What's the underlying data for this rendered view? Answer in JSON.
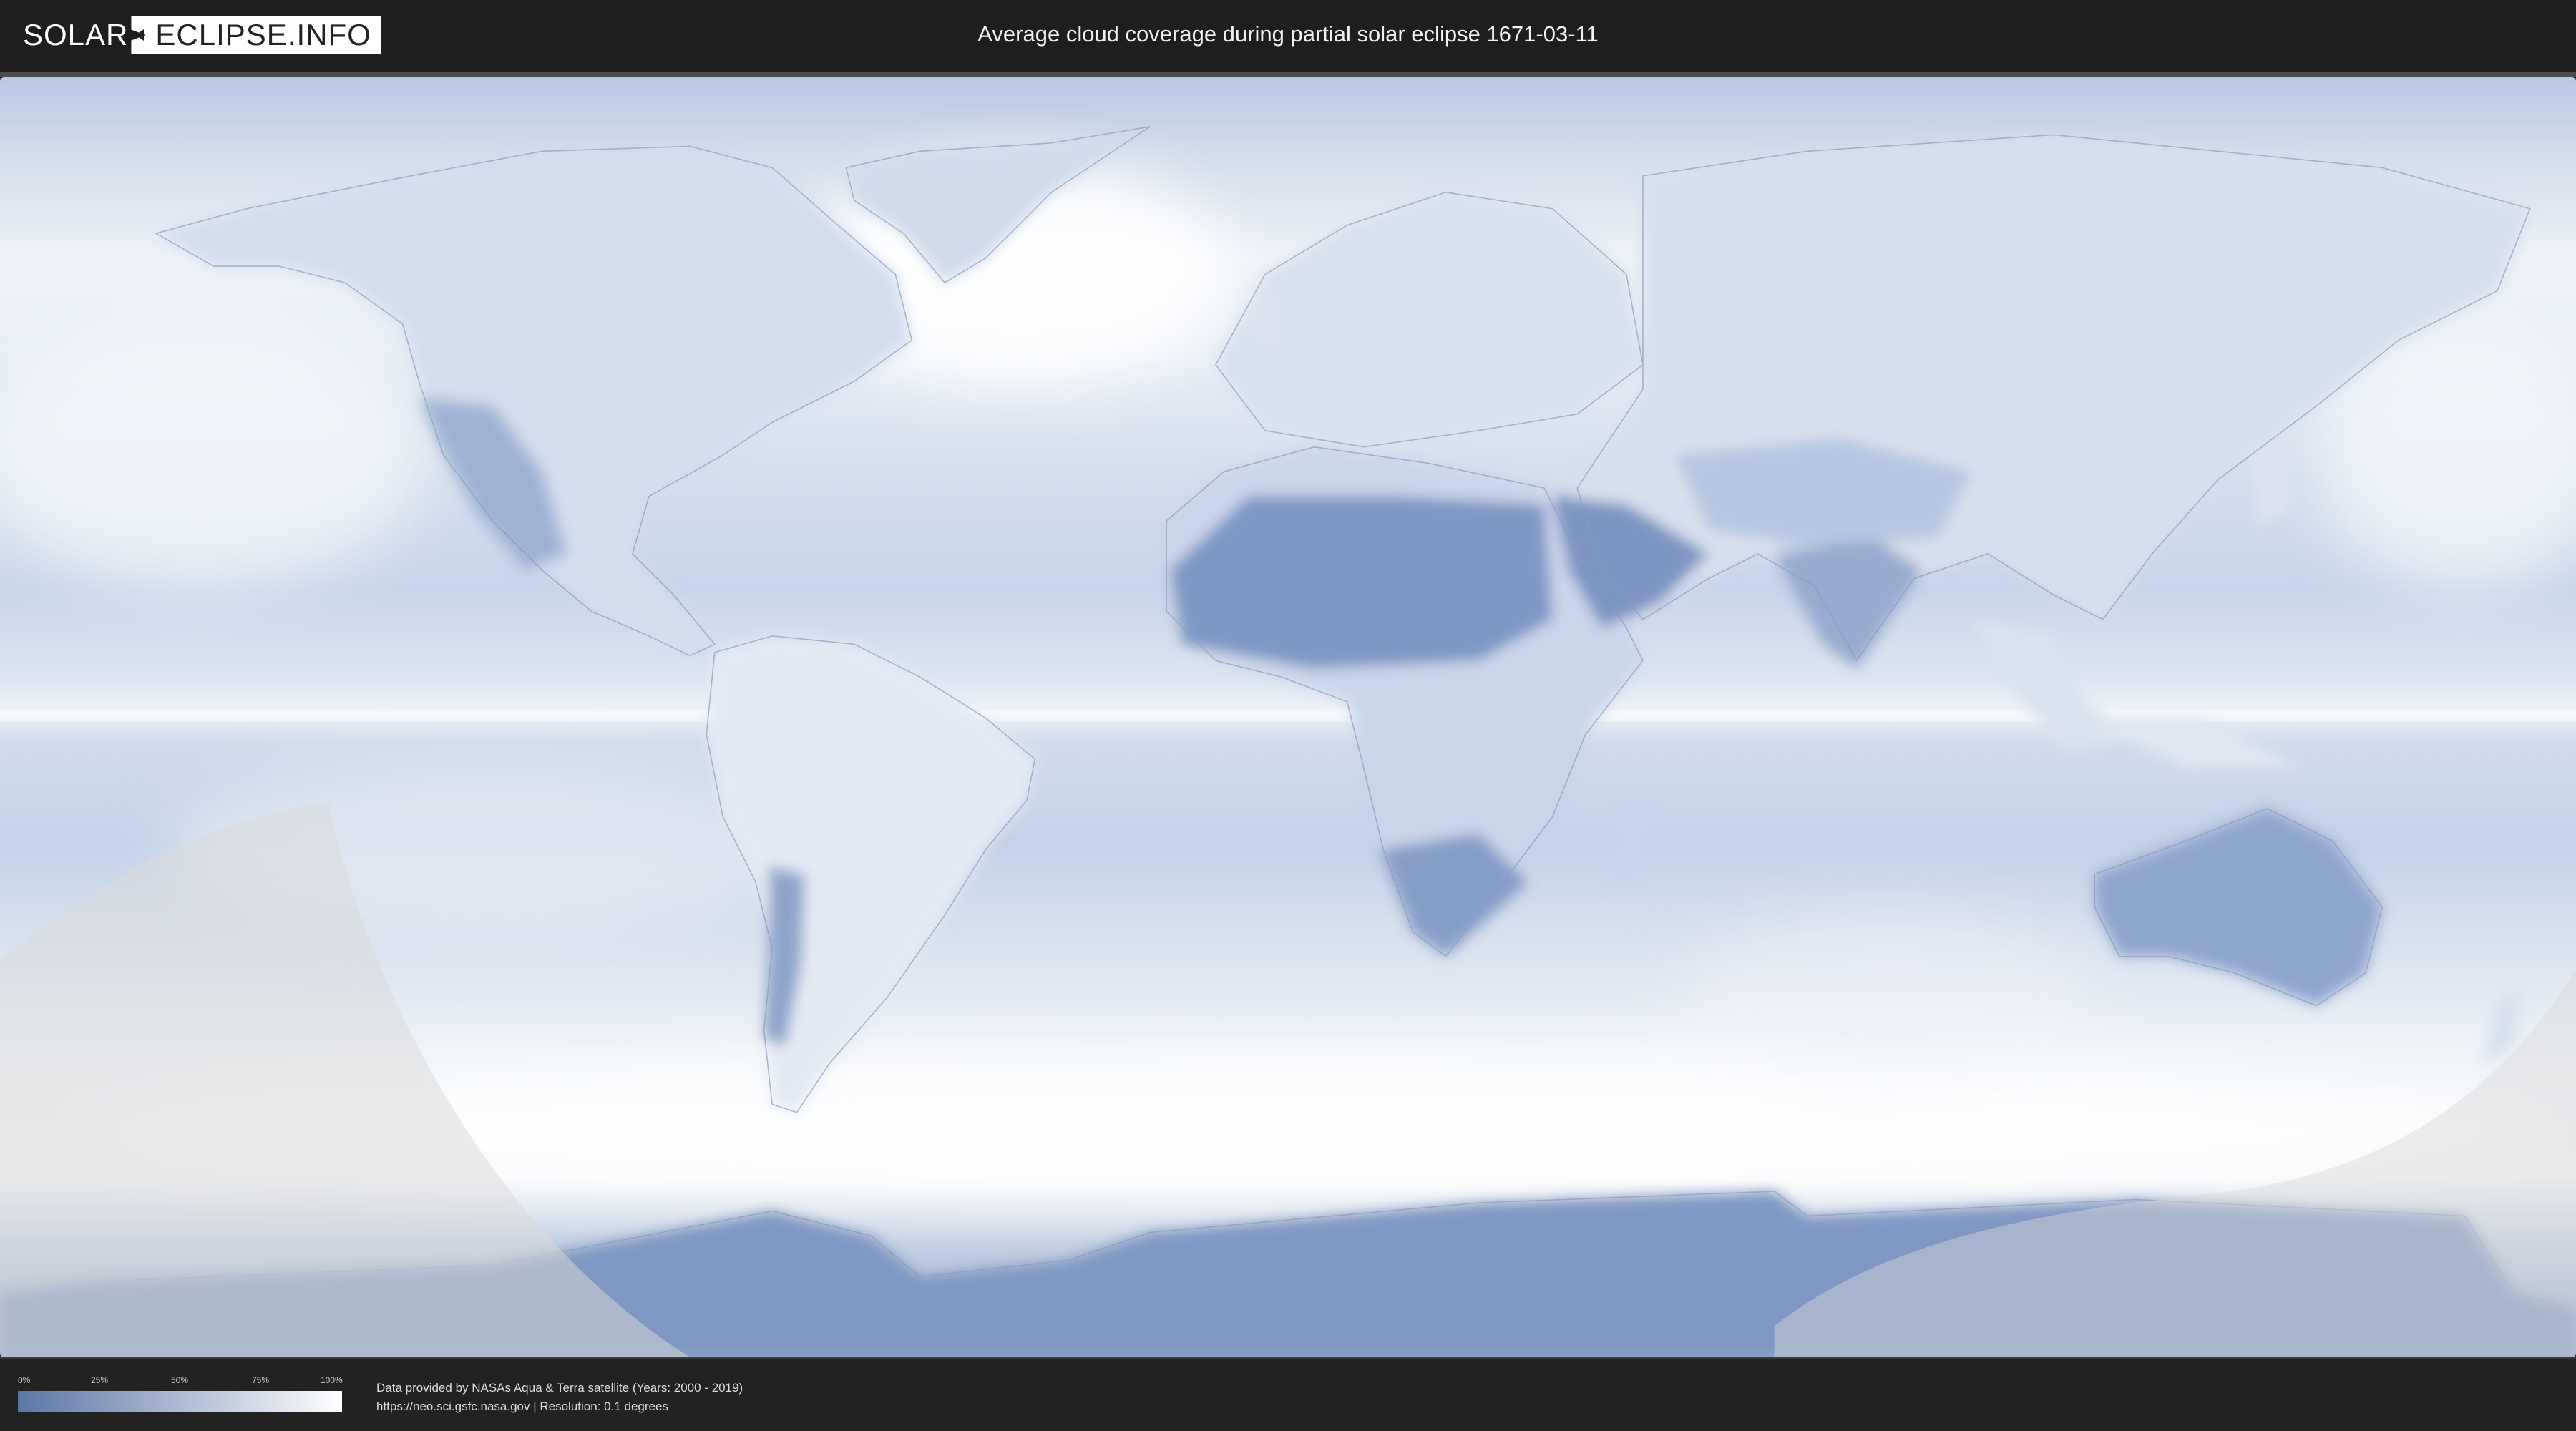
{
  "logo": {
    "part1": "SOLAR",
    "part2": "ECLIPSE.INFO"
  },
  "header": {
    "title": "Average cloud coverage during partial solar eclipse 1671-03-11"
  },
  "legend": {
    "labels": [
      "0%",
      "25%",
      "50%",
      "75%",
      "100%"
    ],
    "color_low": "#5b76a6",
    "color_high": "#ffffff"
  },
  "footer": {
    "line1": "Data provided by NASAs Aqua & Terra satellite (Years: 2000 - 2019)",
    "line2": "https://neo.sci.gsfc.nasa.gov | Resolution: 0.1 degrees"
  },
  "colors": {
    "header_bg": "#1e1e1e",
    "low_cloud": "#7d96c1",
    "high_cloud": "#f4f7fb",
    "eclipse_shadow": "#d8d8d8"
  }
}
